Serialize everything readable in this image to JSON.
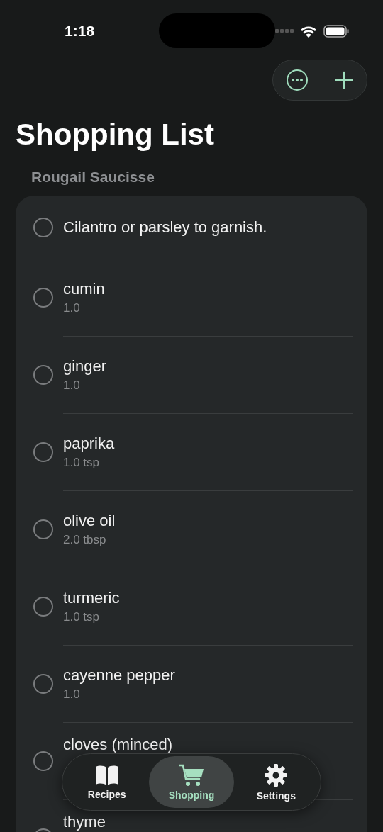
{
  "status_bar": {
    "time": "1:18"
  },
  "title": "Shopping List",
  "section": {
    "title": "Rougail Saucisse",
    "items": [
      {
        "name": "Cilantro or parsley to garnish.",
        "checked": false
      },
      {
        "name": "cumin",
        "quantity": "1.0",
        "checked": false
      },
      {
        "name": "ginger",
        "quantity": "1.0",
        "checked": false
      },
      {
        "name": "paprika",
        "quantity": "1.0 tsp",
        "checked": false
      },
      {
        "name": "olive oil",
        "quantity": "2.0 tbsp",
        "checked": false
      },
      {
        "name": "turmeric",
        "quantity": "1.0 tsp",
        "checked": false
      },
      {
        "name": "cayenne pepper",
        "quantity": "1.0",
        "checked": false
      },
      {
        "name": "cloves (minced)",
        "checked": false
      },
      {
        "name": "thyme",
        "checked": false
      }
    ]
  },
  "tabs": [
    {
      "label": "Recipes",
      "kind": "book",
      "selected": false
    },
    {
      "label": "Shopping",
      "kind": "cart",
      "selected": true
    },
    {
      "label": "Settings",
      "kind": "gear",
      "selected": false
    }
  ]
}
